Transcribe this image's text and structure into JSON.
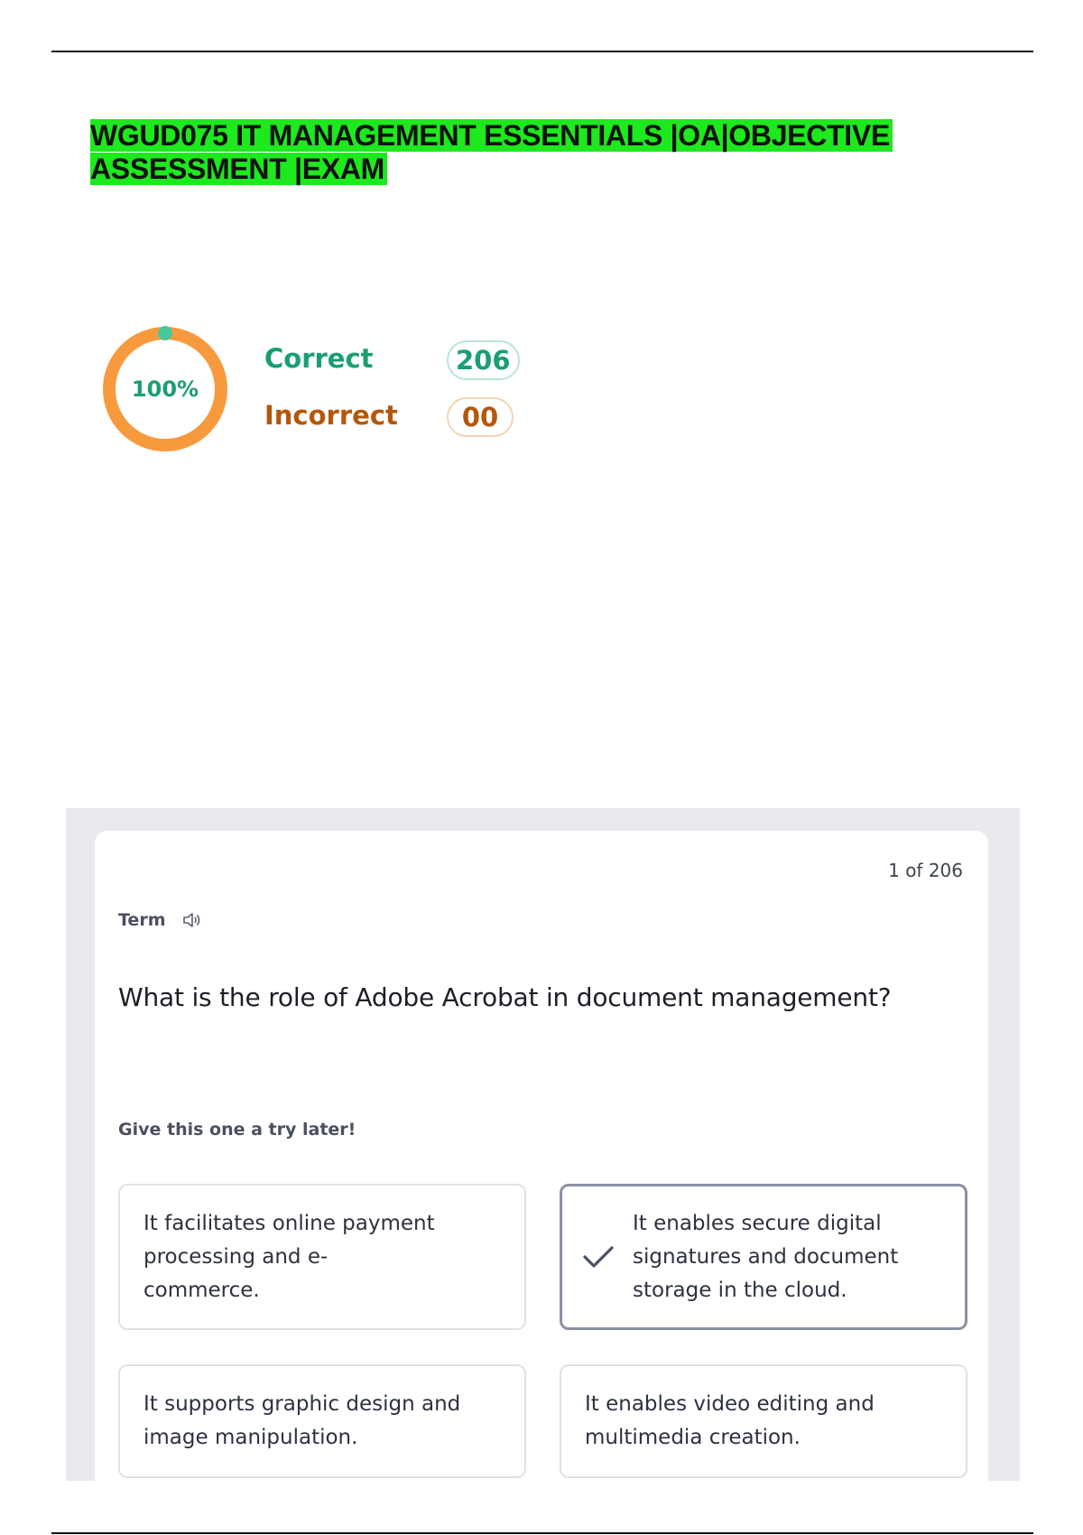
{
  "document": {
    "title_line1": "WGUD075 IT MANAGEMENT ESSENTIALS |OA|OBJECTIVE",
    "title_line2": "ASSESSMENT |EXAM"
  },
  "score": {
    "percent_label": "100%",
    "progress_fraction": 1.0,
    "ring_color": "#f79a3e",
    "marker_color": "#45c79a",
    "correct_label": "Correct",
    "correct_count": "206",
    "incorrect_label": "Incorrect",
    "incorrect_count": "00",
    "correct_color": "#1a9e73",
    "incorrect_color": "#b4570c"
  },
  "flashcard": {
    "counter": "1 of 206",
    "term_label": "Term",
    "question": "What is the role of Adobe Acrobat in document management?",
    "hint": "Give this one a try later!",
    "options": [
      {
        "text": "It facilitates online payment processing and e-commerce.",
        "selected": false
      },
      {
        "text": "It enables secure digital signatures and document storage in the cloud.",
        "selected": true,
        "icon": "check-icon"
      },
      {
        "text": "It supports graphic design and image manipulation.",
        "selected": false
      },
      {
        "text": "It enables video editing and multimedia creation.",
        "selected": false
      }
    ]
  }
}
